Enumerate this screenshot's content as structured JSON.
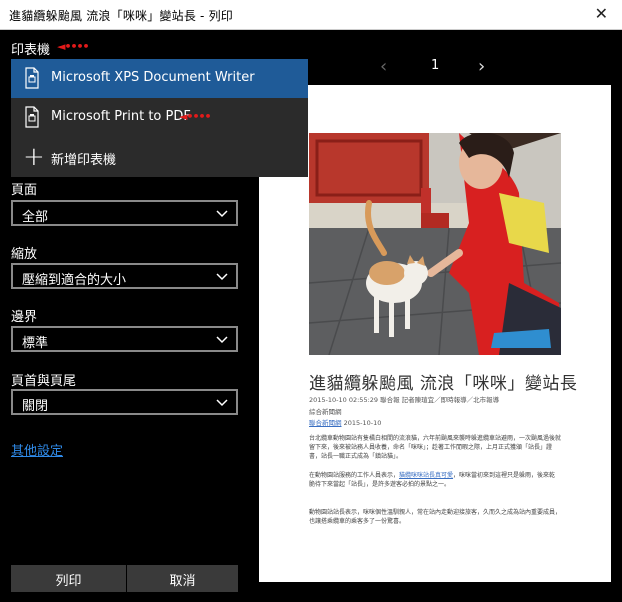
{
  "window": {
    "title": "進貓纜躲颱風 流浪「咪咪」變站長 - 列印",
    "close_glyph": "✕"
  },
  "left": {
    "printer_label": "印表機",
    "printer_options": [
      {
        "label": "Microsoft XPS Document Writer",
        "selected": true
      },
      {
        "label": "Microsoft Print to PDF",
        "selected": false
      },
      {
        "label": "新增印表機",
        "selected": false
      }
    ],
    "pages_label": "頁面",
    "pages_value": "全部",
    "scale_label": "縮放",
    "scale_value": "壓縮到適合的大小",
    "margins_label": "邊界",
    "margins_value": "標準",
    "header_footer_label": "頁首與頁尾",
    "header_footer_value": "關閉",
    "more_settings": "其他設定",
    "print_button": "列印",
    "cancel_button": "取消",
    "annotation_arrow": "◄••••",
    "accent_color": "#1f5b98",
    "link_color": "#2f8ae8"
  },
  "preview": {
    "page_number": "1",
    "prev_glyph": "‹",
    "next_glyph": "›",
    "article": {
      "title": "進貓纜躲颱風 流浪「咪咪」變站長",
      "meta_line": "2015-10-10 02:55:29 聯合報 記者陳瑄宜／即時報導／北市報導",
      "category": "綜合新聞網",
      "category_link": "聯合新聞網",
      "date": "2015-10-10",
      "para1": "台北纜車動物園站有隻橘白相間的流浪貓，六年前颱風來襲時躲進纜車站避雨，一次颱風過後就留下來，後來被站務人員收養，命名「咪咪」；趁著工作閒暇之際，上月正式獲頒「站長」證書，站長一職正式成為「鎮站貓」。",
      "para2_prefix": "在動物園站服務的工作人員表示，",
      "para2_link": "貓纜咪咪站長真可愛",
      "para2_suffix": "，咪咪當初來到這裡只是躲雨，後來乾脆待下來當起「站長」，是許多遊客必拍的景點之一。",
      "para3": "動物園站站長表示，咪咪個性溫馴親人，常在站內走動迎接旅客，久而久之成為站內重要成員，也讓搭乘纜車的乘客多了一份驚喜。"
    }
  }
}
